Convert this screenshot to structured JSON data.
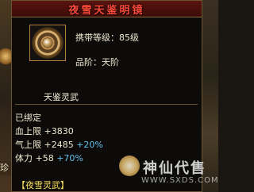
{
  "tooltip": {
    "title": "夜雪天鉴明镜",
    "carry_level": "携带等级：85级",
    "grade": "品阶：天阶",
    "subname": "天鉴灵武",
    "bound": "已绑定",
    "stats": [
      {
        "label": "血上限",
        "value": "+3830",
        "bonus": ""
      },
      {
        "label": "气上限",
        "value": "+2485",
        "bonus": "+20%"
      },
      {
        "label": "体力",
        "value": "+58",
        "bonus": "+70%"
      }
    ],
    "set_name": "【夜雪灵武】"
  },
  "side": {
    "left_label": "珍"
  },
  "watermark": {
    "brand": "神仙代售",
    "url": "WWW.SXDS.COM"
  },
  "colors": {
    "title": "#ff4a3a",
    "bonus": "#60c0e8",
    "set_name": "#f8e060",
    "border": "#6b5530"
  }
}
